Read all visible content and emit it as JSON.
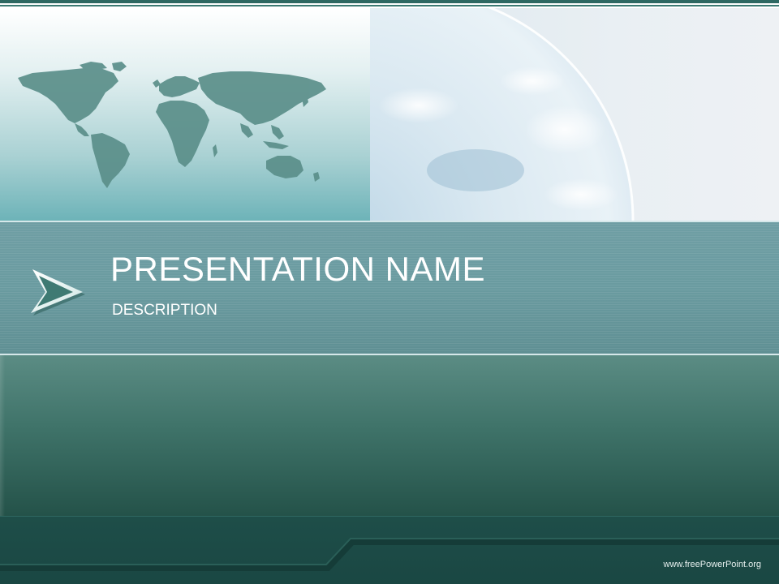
{
  "slide": {
    "title": "PRESENTATION NAME",
    "subtitle": "DESCRIPTION",
    "footer_credit": "www.freePowerPoint.org"
  },
  "colors": {
    "teal_dark": "#1f4f4a",
    "teal_band": "#6a9ba0",
    "map_land": "#5b8f8a",
    "text": "#ffffff"
  },
  "icons": {
    "arrow": "chevron-arrow-icon",
    "map": "world-map-icon",
    "globe": "earth-globe-icon"
  }
}
